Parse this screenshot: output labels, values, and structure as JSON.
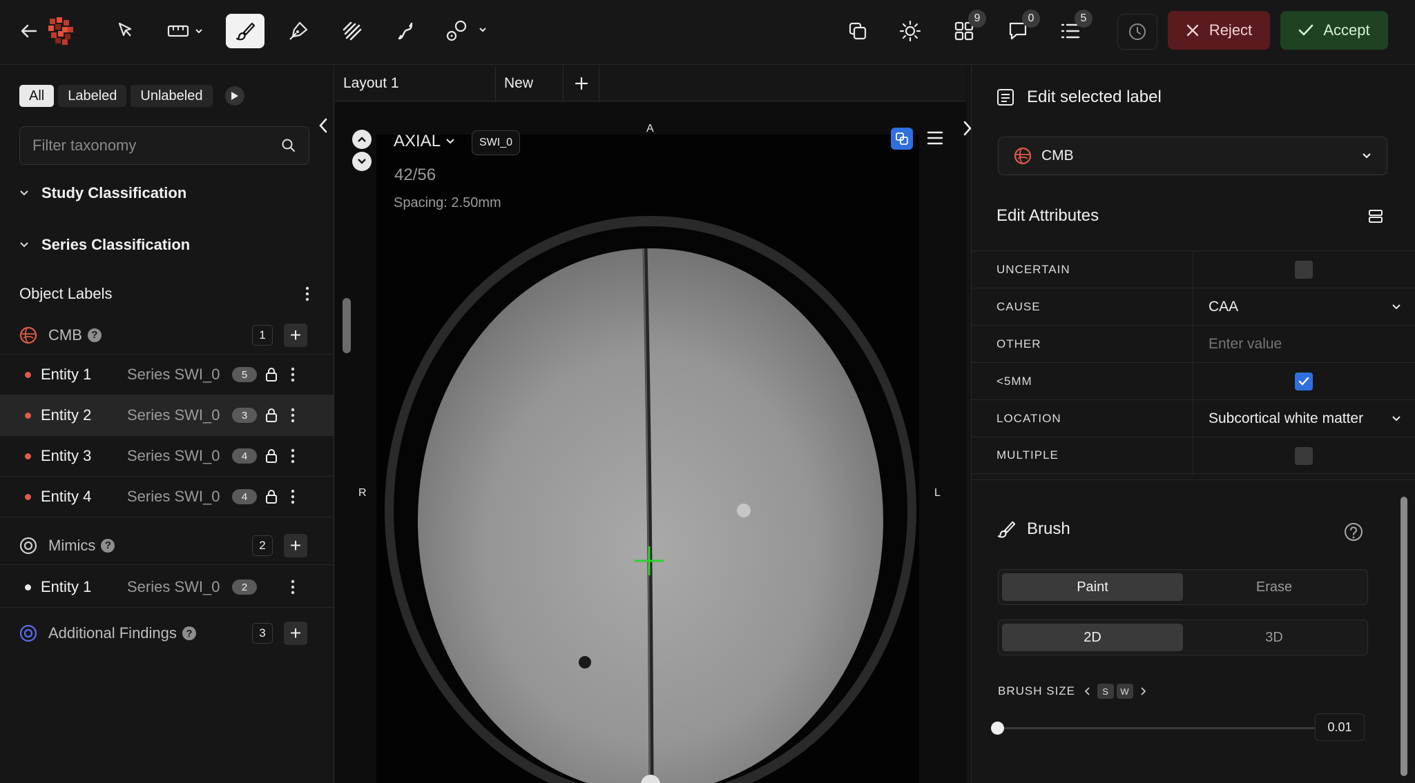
{
  "toolbar": {
    "reject_label": "Reject",
    "accept_label": "Accept",
    "badges": {
      "grid": "9",
      "comments": "0",
      "list": "5"
    }
  },
  "left": {
    "filters": [
      "All",
      "Labeled",
      "Unlabeled"
    ],
    "search_placeholder": "Filter taxonomy",
    "study_classification": "Study Classification",
    "series_classification": "Series Classification",
    "object_labels": "Object Labels",
    "classes": [
      {
        "name": "CMB",
        "count": "1",
        "color": "#e05a4a",
        "entities": [
          {
            "name": "Entity 1",
            "series": "Series SWI_0",
            "badge": "5"
          },
          {
            "name": "Entity 2",
            "series": "Series SWI_0",
            "badge": "3"
          },
          {
            "name": "Entity 3",
            "series": "Series SWI_0",
            "badge": "4"
          },
          {
            "name": "Entity 4",
            "series": "Series SWI_0",
            "badge": "4"
          }
        ]
      },
      {
        "name": "Mimics",
        "count": "2",
        "color": "#cfcfcf",
        "entities": [
          {
            "name": "Entity 1",
            "series": "Series SWI_0",
            "badge": "2"
          }
        ]
      },
      {
        "name": "Additional Findings",
        "count": "3",
        "color": "#5b6cf0",
        "entities": []
      }
    ]
  },
  "center": {
    "tabs": [
      "Layout 1",
      "New"
    ],
    "view": "AXIAL",
    "series": "SWI_0",
    "slice": "42/56",
    "spacing": "Spacing: 2.50mm",
    "orient": {
      "top": "A",
      "left": "R",
      "right": "L"
    }
  },
  "right": {
    "title": "Edit selected label",
    "selected_label": "CMB",
    "attributes_title": "Edit Attributes",
    "attributes": [
      {
        "key": "UNCERTAIN",
        "type": "checkbox",
        "checked": false
      },
      {
        "key": "CAUSE",
        "type": "select",
        "value": "CAA"
      },
      {
        "key": "OTHER",
        "type": "text",
        "placeholder": "Enter value"
      },
      {
        "key": "<5MM",
        "type": "checkbox",
        "checked": true
      },
      {
        "key": "LOCATION",
        "type": "select",
        "value": "Subcortical white matter"
      },
      {
        "key": "MULTIPLE",
        "type": "checkbox",
        "checked": false
      }
    ],
    "brush": {
      "title": "Brush",
      "mode_options": [
        "Paint",
        "Erase"
      ],
      "mode_selected": "Paint",
      "dim_options": [
        "2D",
        "3D"
      ],
      "dim_selected": "2D",
      "size_label": "BRUSH SIZE",
      "shortcuts": [
        "S",
        "W"
      ],
      "size_value": "0.01"
    }
  },
  "colors": {
    "reject_bg": "#5a1b1e",
    "accept_bg": "#1e4222",
    "crosshair": "#2ed12e",
    "checkbox_on": "#2f6fe0"
  }
}
